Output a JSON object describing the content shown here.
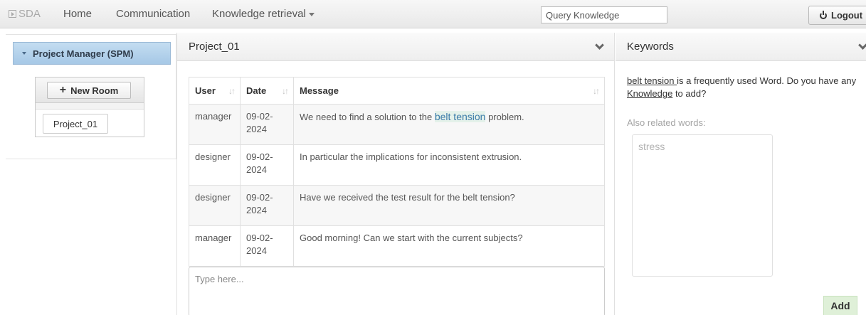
{
  "navbar": {
    "brand": "SDA",
    "links": [
      {
        "label": "Home"
      },
      {
        "label": "Communication"
      },
      {
        "label": "Knowledge retrieval"
      }
    ],
    "search_placeholder": "Query Knowledge",
    "logout_label": "Logout"
  },
  "sidebar": {
    "header": "Project Manager (SPM)",
    "new_room_label": "New Room",
    "rooms": [
      "Project_01"
    ]
  },
  "chat": {
    "title": "Project_01",
    "columns": [
      "User",
      "Date",
      "Message"
    ],
    "highlight_keyword": "belt tension",
    "rows": [
      {
        "user": "manager",
        "date": "09-02-2024",
        "message_before": "We need to find a solution to the ",
        "message_after": " problem."
      },
      {
        "user": "designer",
        "date": "09-02-2024",
        "message": "In particular the implications for inconsistent extrusion."
      },
      {
        "user": "designer",
        "date": "09-02-2024",
        "message": "Have we received the test result for the belt tension?"
      },
      {
        "user": "manager",
        "date": "09-02-2024",
        "message": "Good morning! Can we start with the current subjects?"
      }
    ],
    "input_placeholder": "Type here..."
  },
  "keywords": {
    "title": "Keywords",
    "keyword": "belt tension ",
    "info_middle": "is a frequently used Word. Do you have any ",
    "knowledge_link": "Knowledge",
    "info_end": " to add?",
    "related_label": "Also related words:",
    "related_words": "stress",
    "add_label": "Add"
  }
}
